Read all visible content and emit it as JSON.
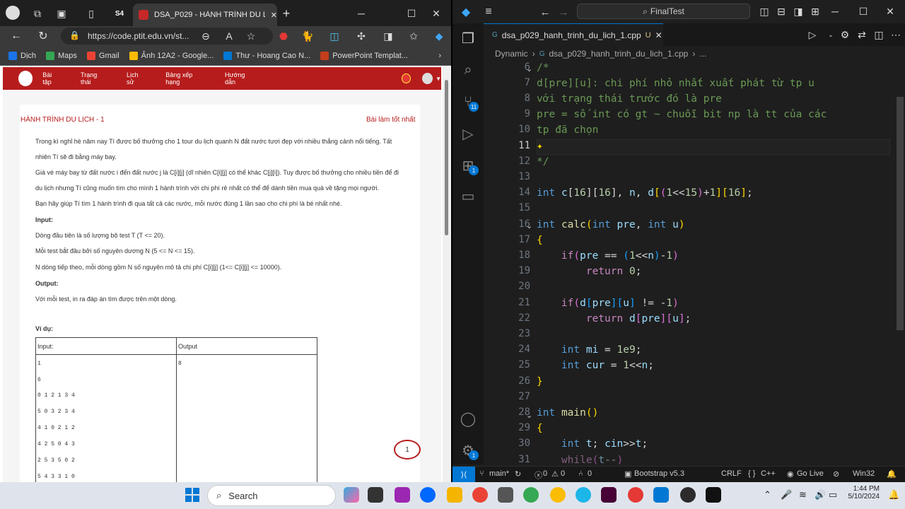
{
  "browser": {
    "tab_title": "DSA_P029 - HÀNH TRÌNH DU LỊ",
    "url": "https://code.ptit.edu.vn/st...",
    "bookmarks": [
      {
        "label": "Dịch",
        "color": "#1a73e8"
      },
      {
        "label": "Maps",
        "color": "#34a853"
      },
      {
        "label": "Gmail",
        "color": "#ea4335"
      },
      {
        "label": "Ảnh 12A2 - Google...",
        "color": "#fbbc04"
      },
      {
        "label": "Thư - Hoang Cao N...",
        "color": "#0078d4"
      },
      {
        "label": "PowerPoint Templat...",
        "color": "#c43e1c"
      }
    ]
  },
  "site": {
    "nav": [
      "Bài tập",
      "Trạng thái",
      "Lịch sử",
      "Bảng xếp hạng",
      "Hướng dẫn"
    ],
    "problem_title": "HÀNH TRÌNH DU LỊCH - 1",
    "best_link": "Bài làm tốt nhất",
    "paragraphs": [
      "Trong kì nghỉ hè năm nay Tí được bố thưởng cho 1 tour du lịch quanh N đất nước tươi đẹp với nhiều thắng cảnh nổi tiếng. Tất",
      "nhiên Tí sẽ đi bằng máy bay.",
      "Giá vé máy bay từ đất nước i đến đất nước j là C[i][j] (dĩ nhiên C[i][j] có thể khác C[j][i]). Tuy được bố thưởng cho nhiều tiền để đi",
      "du lịch nhưng Tí cũng muốn tìm cho mình 1 hành trình với chi phí rẻ nhất có thể để dành tiền mua quà về tặng mọi người.",
      "Bạn hãy giúp Tí tìm 1 hành trình đi qua tất cả các nước, mỗi nước đúng 1 lần sao cho chi phí là bé nhất nhé.",
      "Input:",
      "Dòng đầu tiên là số lượng bộ test T (T <= 20).",
      "Mỗi test bắt đầu bởi số nguyên dương N (5 <= N <= 15).",
      "N dòng tiếp theo, mỗi dòng gồm N số nguyên mô tả chi phí C[i][j] (1<= C[i][j] <= 10000).",
      "Output:",
      "Với mỗi test, in ra đáp án tìm được trên một dòng.",
      "Ví dụ:"
    ],
    "example": {
      "input_header": "Input:",
      "output_header": "Output",
      "input_rows": [
        "1",
        "6",
        "0 1 2 1 3 4",
        "5 0 3 2 3 4",
        "4 1 0 2 1 2",
        "4 2 5 0 4 3",
        "2 5 3 5 0 2",
        "5 4 3 3 1 0"
      ],
      "output_rows": [
        "8"
      ]
    },
    "chat_count": "1"
  },
  "vscode": {
    "search_text": "FinalTest",
    "tab_label": "dsa_p029_hanh_trinh_du_lich_1.cpp",
    "tab_status": "U",
    "breadcrumb": [
      "Dynamic",
      "dsa_p029_hanh_trinh_du_lich_1.cpp",
      "..."
    ],
    "badges": {
      "scm": "11",
      "extensions": "1",
      "settings": "1"
    },
    "line_numbers": [
      "6",
      "7",
      "8",
      "9",
      "10",
      "11",
      "12",
      "13",
      "14",
      "15",
      "16",
      "17",
      "18",
      "19",
      "20",
      "21",
      "22",
      "23",
      "24",
      "25",
      "26",
      "27",
      "28",
      "29",
      "30",
      "31"
    ],
    "current_line": "11",
    "status": {
      "branch": "main*",
      "errors": "0",
      "warnings": "0",
      "ports": "0",
      "bootstrap": "Bootstrap v5.3",
      "eol": "CRLF",
      "language": "C++",
      "golive": "Go Live",
      "platform": "Win32"
    }
  },
  "taskbar": {
    "search_placeholder": "Search",
    "time": "1:44 PM",
    "date": "5/10/2024"
  }
}
